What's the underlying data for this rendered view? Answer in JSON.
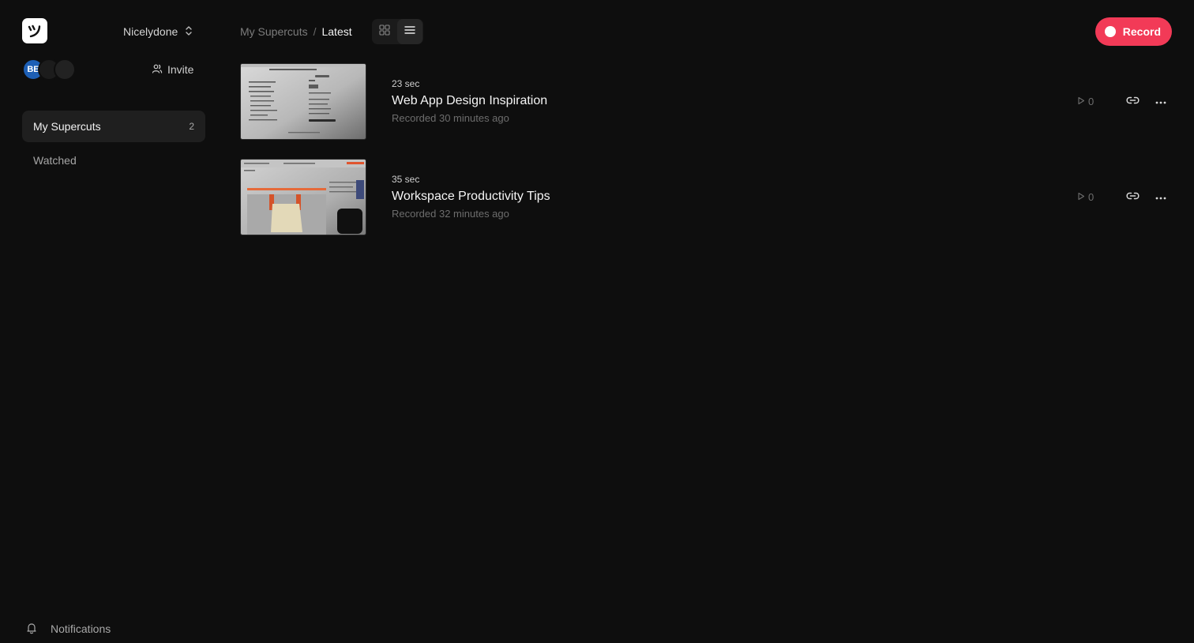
{
  "sidebar": {
    "logo_icon": "supercut-logo-icon",
    "workspace_name": "Nicelydone",
    "avatars": [
      {
        "initials": "BE",
        "color": "#1d5fb5"
      },
      {
        "initials": "",
        "color": "#1c1c1c"
      },
      {
        "initials": "",
        "color": "#222222"
      }
    ],
    "invite_label": "Invite",
    "nav": [
      {
        "label": "My Supercuts",
        "count": "2",
        "active": true
      },
      {
        "label": "Watched",
        "count": "",
        "active": false
      }
    ],
    "notifications_label": "Notifications"
  },
  "header": {
    "breadcrumb_parent": "My Supercuts",
    "breadcrumb_separator": "/",
    "breadcrumb_current": "Latest",
    "view_modes": [
      "grid-view-icon",
      "list-view-icon"
    ],
    "active_view": "list",
    "record_label": "Record",
    "record_color": "#f23a57"
  },
  "videos": [
    {
      "duration": "23 sec",
      "title": "Web App Design Inspiration",
      "recorded": "Recorded 30 minutes ago",
      "views": "0"
    },
    {
      "duration": "35 sec",
      "title": "Workspace Productivity Tips",
      "recorded": "Recorded 32 minutes ago",
      "views": "0"
    }
  ]
}
